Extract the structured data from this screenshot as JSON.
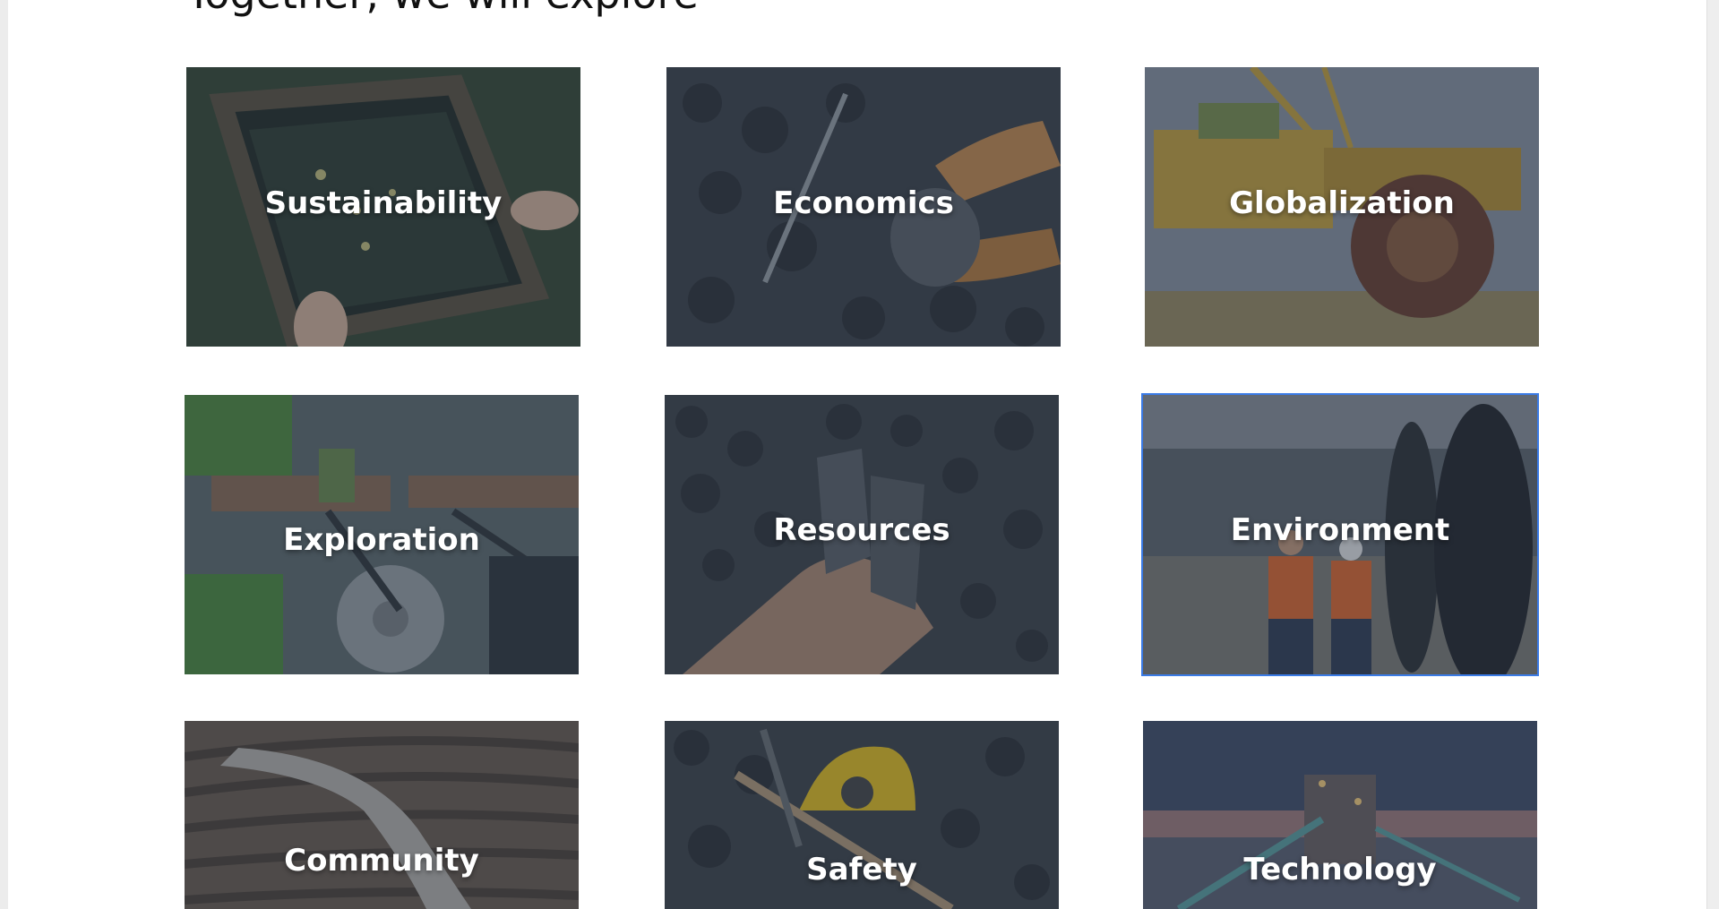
{
  "section": {
    "heading": "Together, we will explore"
  },
  "tiles": [
    {
      "label": "Sustainability",
      "image": "hands-sifting-sieve-in-water",
      "selected": false
    },
    {
      "label": "Economics",
      "image": "gloved-hands-holding-coal",
      "selected": false
    },
    {
      "label": "Globalization",
      "image": "bucket-wheel-excavator",
      "selected": false
    },
    {
      "label": "Exploration",
      "image": "aerial-quarry-machinery",
      "selected": false
    },
    {
      "label": "Resources",
      "image": "hand-holding-coal-lumps",
      "selected": false
    },
    {
      "label": "Environment",
      "image": "workers-next-to-mining-truck-tires",
      "selected": true
    },
    {
      "label": "Community",
      "image": "open-pit-mine-terraces",
      "selected": false
    },
    {
      "label": "Safety",
      "image": "hard-hat-and-pickaxe-on-coal",
      "selected": false
    },
    {
      "label": "Technology",
      "image": "processing-plant-at-dusk",
      "selected": false
    }
  ],
  "colors": {
    "selected_outline": "#3b7be6",
    "tile_shade": "#283446"
  }
}
